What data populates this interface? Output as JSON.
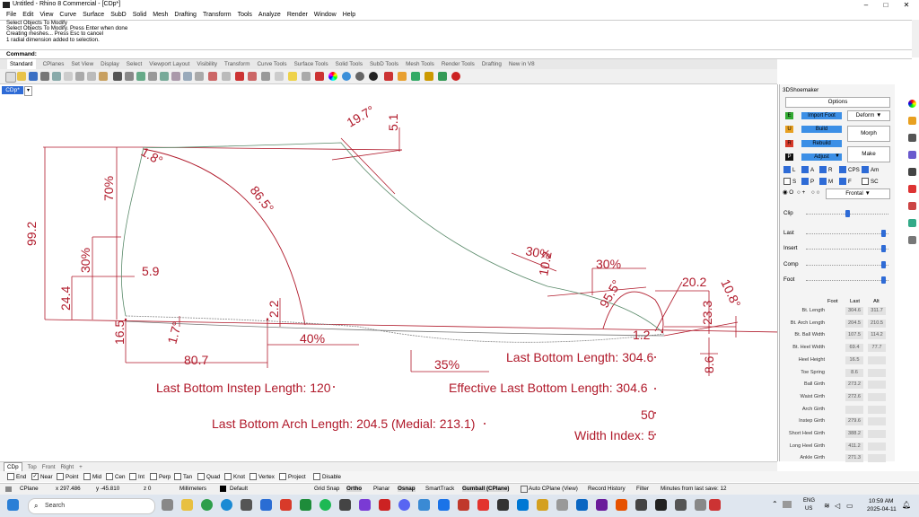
{
  "window": {
    "title": "Untitled - Rhino 8 Commercial - [CDp*]"
  },
  "menu": [
    "File",
    "Edit",
    "View",
    "Curve",
    "Surface",
    "SubD",
    "Solid",
    "Mesh",
    "Drafting",
    "Transform",
    "Tools",
    "Analyze",
    "Render",
    "Window",
    "Help"
  ],
  "command_history": [
    "Select Objects To Modify",
    "Select Objects To Modify. Press Enter when done",
    "Creating meshes... Press Esc to cancel",
    "1 radial dimension added to selection."
  ],
  "command_prompt": "Command:",
  "toolbar_tabs": [
    "Standard",
    "CPlanes",
    "Set View",
    "Display",
    "Select",
    "Viewport Layout",
    "Visibility",
    "Transform",
    "Curve Tools",
    "Surface Tools",
    "Solid Tools",
    "SubD Tools",
    "Mesh Tools",
    "Render Tools",
    "Drafting",
    "New in V8"
  ],
  "viewport": {
    "active_tab": "CDp*",
    "dropdown": "▾"
  },
  "drawing": {
    "dims": {
      "d_99_2": "99.2",
      "d_70": "70%",
      "d_30_left": "30%",
      "d_24_4": "24.4",
      "d_5_9": "5.9",
      "d_1_8": "1.8°",
      "d_86_5": "86.5°",
      "d_19_7": "19.7°",
      "d_5_1": "5.1",
      "d_16_5": "16.5",
      "d_1_7": "1.7°",
      "d_2_2": "2.2",
      "d_40": "40%",
      "d_80_7": "80.7",
      "d_35": "35%",
      "d_30_mid": "30%",
      "d_10_2": "10.2",
      "d_30_top": "30%",
      "d_95_5": "95.5°",
      "d_20_2": "20.2",
      "d_10_8": "10.8°",
      "d_23_3": "23.3",
      "d_1_2": "1.2",
      "d_8_6": "8.6"
    },
    "labels": {
      "last_bottom_length": "Last Bottom Length: 304.6",
      "instep_length": "Last Bottom Instep Length: 120",
      "effective_length": "Effective Last Bottom Length: 304.6",
      "arch_length": "Last Bottom Arch Length: 204.5 (Medial: 213.1)",
      "value_50": "50",
      "width_index": "Width Index: 5"
    }
  },
  "viewport_tabs": [
    "CDp",
    "Top",
    "Front",
    "Right",
    "+"
  ],
  "osnaps": [
    {
      "label": "End",
      "checked": false
    },
    {
      "label": "Near",
      "checked": true
    },
    {
      "label": "Point",
      "checked": false
    },
    {
      "label": "Mid",
      "checked": false
    },
    {
      "label": "Cen",
      "checked": false
    },
    {
      "label": "Int",
      "checked": false
    },
    {
      "label": "Perp",
      "checked": false
    },
    {
      "label": "Tan",
      "checked": false
    },
    {
      "label": "Quad",
      "checked": false
    },
    {
      "label": "Knot",
      "checked": false
    },
    {
      "label": "Vertex",
      "checked": false
    },
    {
      "label": "Project",
      "checked": false
    },
    {
      "label": "Disable",
      "checked": false
    }
  ],
  "status": {
    "cplane": "CPlane",
    "x": "x 297.486",
    "y": "y -45.810",
    "z": "z 0",
    "units": "Millimeters",
    "layer": "Default",
    "items": [
      "Grid Snap",
      "Ortho",
      "Planar",
      "Osnap",
      "SmartTrack",
      "Gumball (CPlane)",
      "Auto CPlane (View)",
      "Record History",
      "Filter"
    ],
    "last_save": "Minutes from last save: 12"
  },
  "taskbar": {
    "search": "Search",
    "lang": "ENG",
    "region": "US",
    "time": "10:59 AM",
    "date": "2025-04-11"
  },
  "panel": {
    "title": "3DShoemaker",
    "options": "Options",
    "import_foot": "Import Foot",
    "build": "Build",
    "rebuild": "Rebuild",
    "adjust": "Adjust",
    "e": "E",
    "u": "U",
    "r": "R",
    "p": "P",
    "deform": "Deform",
    "morph": "Morph",
    "make": "Make",
    "checks_row1": [
      {
        "l": "L",
        "on": true
      },
      {
        "l": "A",
        "on": true
      },
      {
        "l": "R",
        "on": true
      },
      {
        "l": "CPS",
        "on": true
      },
      {
        "l": "Am",
        "on": true
      }
    ],
    "checks_row2": [
      {
        "l": "S",
        "on": false
      },
      {
        "l": "P",
        "on": true
      },
      {
        "l": "M",
        "on": true
      },
      {
        "l": "F",
        "on": true
      },
      {
        "l": "SC",
        "on": false
      }
    ],
    "view_select": "Frontal",
    "radio_o": "O",
    "radio_plus": "+",
    "radio_dot": "○",
    "sliders": [
      {
        "name": "Clip",
        "level": 0.5
      },
      {
        "name": "Last",
        "level": 0.95
      },
      {
        "name": "Insert",
        "level": 0.95
      },
      {
        "name": "Comp",
        "level": 0.95
      },
      {
        "name": "Foot",
        "level": 0.95
      }
    ],
    "table_head": {
      "foot": "Foot",
      "last": "Last",
      "alt": "Alt"
    },
    "table": [
      {
        "name": "Bt. Length",
        "last": "304.6",
        "alt": "311.7"
      },
      {
        "name": "Bt. Arch Length",
        "last": "204.5",
        "alt": "210.5"
      },
      {
        "name": "Bt. Ball Width",
        "last": "107.5",
        "alt": "114.2"
      },
      {
        "name": "Bt. Heel Width",
        "last": "69.4",
        "alt": "77.7"
      },
      {
        "name": "Heel Height",
        "last": "16.5",
        "alt": ""
      },
      {
        "name": "Toe Spring",
        "last": "8.6",
        "alt": ""
      },
      {
        "name": "Ball Girth",
        "last": "273.2",
        "alt": ""
      },
      {
        "name": "Waist Girth",
        "last": "272.6",
        "alt": ""
      },
      {
        "name": "Arch Girth",
        "last": "",
        "alt": ""
      },
      {
        "name": "Instep Girth",
        "last": "279.6",
        "alt": ""
      },
      {
        "name": "Short Heel Girth",
        "last": "388.2",
        "alt": ""
      },
      {
        "name": "Long Heel Girth",
        "last": "411.2",
        "alt": ""
      },
      {
        "name": "Ankle Girth",
        "last": "271.3",
        "alt": ""
      }
    ]
  }
}
